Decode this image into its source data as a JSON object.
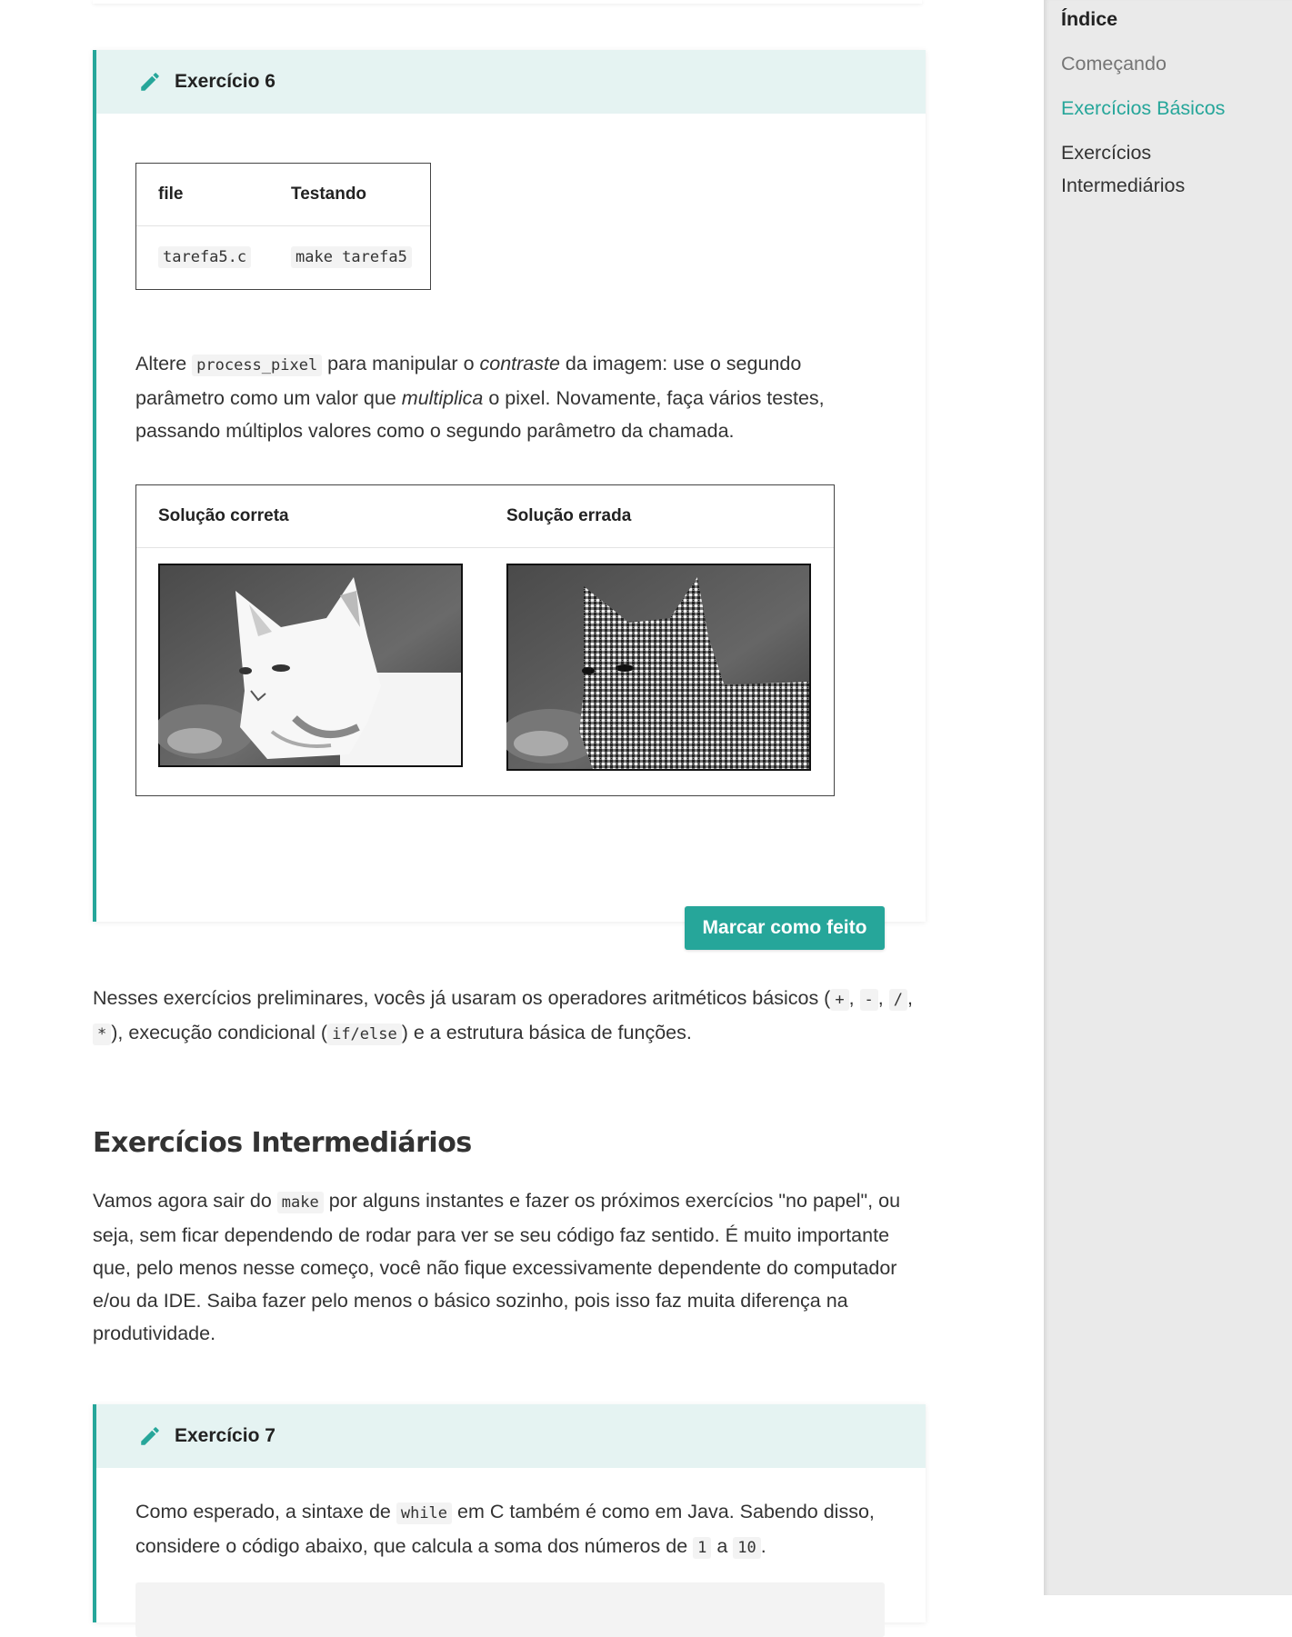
{
  "exercise6": {
    "title": "Exercício 6",
    "files_table": {
      "headers": [
        "file",
        "Testando"
      ],
      "row": [
        "tarefa5.c",
        "make tarefa5"
      ]
    },
    "paragraph": {
      "t1": "Altere ",
      "code1": "process_pixel",
      "t2": " para manipular o ",
      "em1": "contraste",
      "t3": " da imagem: use o segundo parâmetro como um valor que ",
      "em2": "multiplica",
      "t4": " o pixel. Novamente, faça vários testes, passando múltiplos valores como o segundo parâmetro da chamada."
    },
    "solutions_table": {
      "headers": [
        "Solução correta",
        "Solução errada"
      ]
    },
    "button_label": "Marcar como feito"
  },
  "summary": {
    "t1": "Nesses exercícios preliminares, vocês já usaram os operadores aritméticos básicos (",
    "op1": "+",
    "sep1": ", ",
    "op2": "-",
    "sep2": ", ",
    "op3": "/",
    "sep3": ", ",
    "op4": "*",
    "t2": "), execução condicional (",
    "code": "if/else",
    "t3": ") e a estrutura básica de funções."
  },
  "intermediate": {
    "heading": "Exercícios Intermediários",
    "t1": "Vamos agora sair do ",
    "code": "make",
    "t2": " por alguns instantes e fazer os próximos exercícios \"no papel\", ou seja, sem ficar dependendo de rodar para ver se seu código faz sentido. É muito importante que, pelo menos nesse começo, você não fique excessivamente dependente do computador e/ou da IDE. Saiba fazer pelo menos o básico sozinho, pois isso faz muita diferença na produtividade."
  },
  "exercise7": {
    "title": "Exercício 7",
    "t1": "Como esperado, a sintaxe de ",
    "code1": "while",
    "t2": " em C também é como em Java. Sabendo disso, considere o código abaixo, que calcula a soma dos números de ",
    "code2": "1",
    "t3": " a ",
    "code3": "10",
    "t4": "."
  },
  "sidebar": {
    "title": "Índice",
    "items": [
      "Começando",
      "Exercícios Básicos",
      "Exercícios Intermediários"
    ],
    "active_index": 1
  },
  "colors": {
    "accent": "#26a69a",
    "header_bg": "#e5f3f2",
    "sidebar_bg": "#eaeaea"
  },
  "icons": [
    "pencil-icon"
  ]
}
